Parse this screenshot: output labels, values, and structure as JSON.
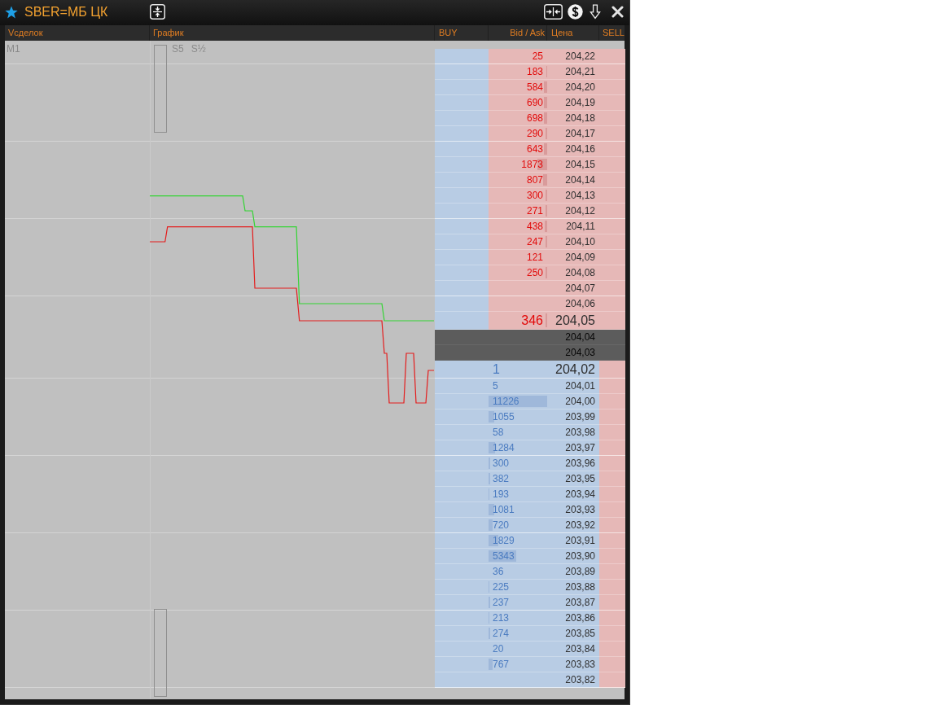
{
  "window": {
    "title": "SBER=МБ ЦК"
  },
  "columns": [
    {
      "label": "Vсделок"
    },
    {
      "label": "График"
    },
    {
      "label": "BUY"
    },
    {
      "label": "Bid / Ask"
    },
    {
      "label": "Цена"
    },
    {
      "label": "SELL"
    }
  ],
  "trades_panel": {
    "timeframe": "M1"
  },
  "chart_panel": {
    "scales": [
      "S5",
      "S½"
    ]
  },
  "order_book": {
    "rows": [
      {
        "kind": "ask",
        "price": "204,22",
        "volume": "25",
        "best": false
      },
      {
        "kind": "ask",
        "price": "204,21",
        "volume": "183",
        "level": 0.016,
        "best": false
      },
      {
        "kind": "ask",
        "price": "204,20",
        "volume": "584",
        "level": 0.052,
        "best": false
      },
      {
        "kind": "ask",
        "price": "204,19",
        "volume": "690",
        "level": 0.061,
        "best": false
      },
      {
        "kind": "ask",
        "price": "204,18",
        "volume": "698",
        "level": 0.062,
        "best": false
      },
      {
        "kind": "ask",
        "price": "204,17",
        "volume": "290",
        "level": 0.026,
        "best": false
      },
      {
        "kind": "ask",
        "price": "204,16",
        "volume": "643",
        "level": 0.057,
        "best": false
      },
      {
        "kind": "ask",
        "price": "204,15",
        "volume": "1873",
        "level": 0.167,
        "best": false
      },
      {
        "kind": "ask",
        "price": "204,14",
        "volume": "807",
        "level": 0.072,
        "best": false
      },
      {
        "kind": "ask",
        "price": "204,13",
        "volume": "300",
        "level": 0.027,
        "best": false
      },
      {
        "kind": "ask",
        "price": "204,12",
        "volume": "271",
        "level": 0.024,
        "best": false
      },
      {
        "kind": "ask",
        "price": "204,11",
        "volume": "438",
        "level": 0.039,
        "best": false
      },
      {
        "kind": "ask",
        "price": "204,10",
        "volume": "247",
        "level": 0.022,
        "best": false
      },
      {
        "kind": "ask",
        "price": "204,09",
        "volume": "121",
        "best": false
      },
      {
        "kind": "ask",
        "price": "204,08",
        "volume": "250",
        "level": 0.022,
        "best": false
      },
      {
        "kind": "ask",
        "price": "204,07",
        "best": false
      },
      {
        "kind": "ask",
        "price": "204,06",
        "best": false
      },
      {
        "kind": "ask",
        "price": "204,05",
        "volume": "346",
        "level": 0.031,
        "best": true
      },
      {
        "kind": "spread",
        "price": "204,04",
        "best": false
      },
      {
        "kind": "spread",
        "price": "204,03",
        "best": false
      },
      {
        "kind": "bid",
        "price": "204,02",
        "volume": "1",
        "best": true
      },
      {
        "kind": "bid",
        "price": "204,01",
        "volume": "5",
        "best": false
      },
      {
        "kind": "bid",
        "price": "204,00",
        "volume": "11226",
        "level": 1,
        "best": false
      },
      {
        "kind": "bid",
        "price": "203,99",
        "volume": "1055",
        "level": 0.094,
        "best": false
      },
      {
        "kind": "bid",
        "price": "203,98",
        "volume": "58",
        "best": false
      },
      {
        "kind": "bid",
        "price": "203,97",
        "volume": "1284",
        "level": 0.114,
        "best": false
      },
      {
        "kind": "bid",
        "price": "203,96",
        "volume": "300",
        "level": 0.027,
        "best": false
      },
      {
        "kind": "bid",
        "price": "203,95",
        "volume": "382",
        "level": 0.034,
        "best": false
      },
      {
        "kind": "bid",
        "price": "203,94",
        "volume": "193",
        "level": 0.017,
        "best": false
      },
      {
        "kind": "bid",
        "price": "203,93",
        "volume": "1081",
        "level": 0.096,
        "best": false
      },
      {
        "kind": "bid",
        "price": "203,92",
        "volume": "720",
        "level": 0.064,
        "best": false
      },
      {
        "kind": "bid",
        "price": "203,91",
        "volume": "1829",
        "level": 0.163,
        "best": false
      },
      {
        "kind": "bid",
        "price": "203,90",
        "volume": "5343",
        "level": 0.476,
        "best": false
      },
      {
        "kind": "bid",
        "price": "203,89",
        "volume": "36",
        "best": false
      },
      {
        "kind": "bid",
        "price": "203,88",
        "volume": "225",
        "level": 0.02,
        "best": false
      },
      {
        "kind": "bid",
        "price": "203,87",
        "volume": "237",
        "level": 0.021,
        "best": false
      },
      {
        "kind": "bid",
        "price": "203,86",
        "volume": "213",
        "level": 0.019,
        "best": false
      },
      {
        "kind": "bid",
        "price": "203,85",
        "volume": "274",
        "level": 0.024,
        "best": false
      },
      {
        "kind": "bid",
        "price": "203,84",
        "volume": "20",
        "best": false
      },
      {
        "kind": "bid",
        "price": "203,83",
        "volume": "767",
        "level": 0.068,
        "best": false
      },
      {
        "kind": "bid",
        "price": "203,82",
        "best": false
      }
    ]
  }
}
